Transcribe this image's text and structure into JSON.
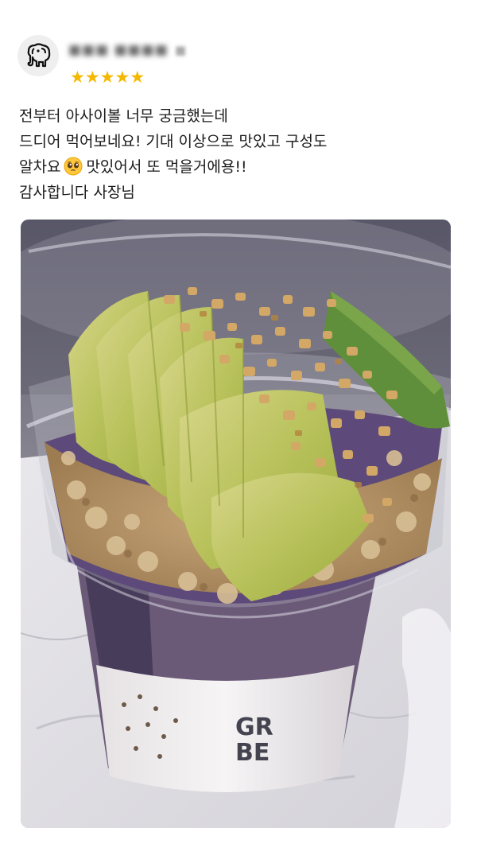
{
  "reviewer": {
    "name": "■■■ ■■■■",
    "name_extra": "■",
    "avatar_icon": "elephant-icon"
  },
  "rating": {
    "stars": 5,
    "max": 5,
    "star_glyph": "★",
    "color": "#f5b800"
  },
  "review": {
    "line1": "전부터 아사이볼 너무 궁금했는데",
    "line2": "드디어 먹어보네요! 기대 이상으로 맛있고 구성도",
    "line3_before": "알차요",
    "line3_emoji": "pleading-face-emoji",
    "line3_after": "맛있어서 또 먹을거에용!!",
    "line4": "감사합니다 사장님"
  },
  "photo": {
    "subject": "acai-bowl-photo",
    "cup_label": "GR BE"
  }
}
